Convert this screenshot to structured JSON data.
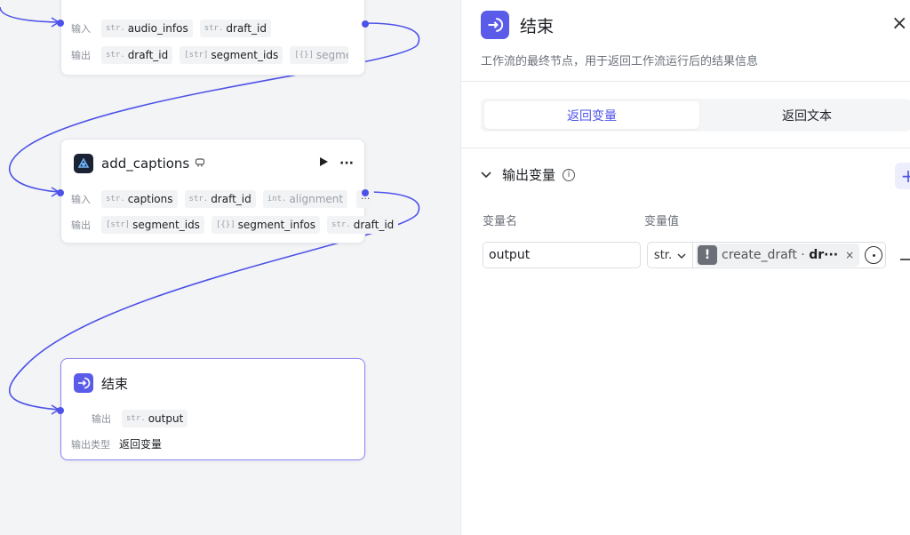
{
  "canvas": {
    "nodes": [
      {
        "id": "node-1",
        "inputs_label": "输入",
        "inputs": [
          {
            "type": "str.",
            "name": "audio_infos"
          },
          {
            "type": "str.",
            "name": "draft_id"
          }
        ],
        "outputs_label": "输出",
        "outputs": [
          {
            "type": "str.",
            "name": "draft_id"
          },
          {
            "type": "[str]",
            "name": "segment_ids"
          },
          {
            "type": "[{}]",
            "name": "segmen"
          }
        ],
        "more": "···"
      },
      {
        "id": "add_captions",
        "title": "add_captions",
        "run_icon": "play-icon",
        "menu": "···",
        "inputs_label": "输入",
        "inputs": [
          {
            "type": "str.",
            "name": "captions"
          },
          {
            "type": "str.",
            "name": "draft_id"
          },
          {
            "type": "int.",
            "name": "alignment"
          }
        ],
        "outputs_label": "输出",
        "outputs": [
          {
            "type": "[str]",
            "name": "segment_ids"
          },
          {
            "type": "[{}]",
            "name": "segment_infos"
          },
          {
            "type": "str.",
            "name": "draft_id"
          }
        ],
        "more": "···"
      },
      {
        "id": "end",
        "title": "结束",
        "outputs_label": "输出",
        "outputs": [
          {
            "type": "str.",
            "name": "output"
          }
        ],
        "output_type_label": "输出类型",
        "output_type_value": "返回变量"
      }
    ],
    "edge_color": "#4d53e8"
  },
  "panel": {
    "title": "结束",
    "description": "工作流的最终节点，用于返回工作流运行后的结果信息",
    "close": "×",
    "tabs": [
      {
        "label": "返回变量",
        "active": true
      },
      {
        "label": "返回文本",
        "active": false
      }
    ],
    "section": {
      "title": "输出变量",
      "add": "+"
    },
    "columns": {
      "name": "变量名",
      "value": "变量值"
    },
    "variable": {
      "name": "output",
      "type": "str.",
      "ref_node": "create_draft",
      "ref_sep": " · ",
      "ref_field": "dr···",
      "remove": "×"
    }
  },
  "colors": {
    "accent": "#4d53e8",
    "end_icon": "#5b5bea"
  }
}
